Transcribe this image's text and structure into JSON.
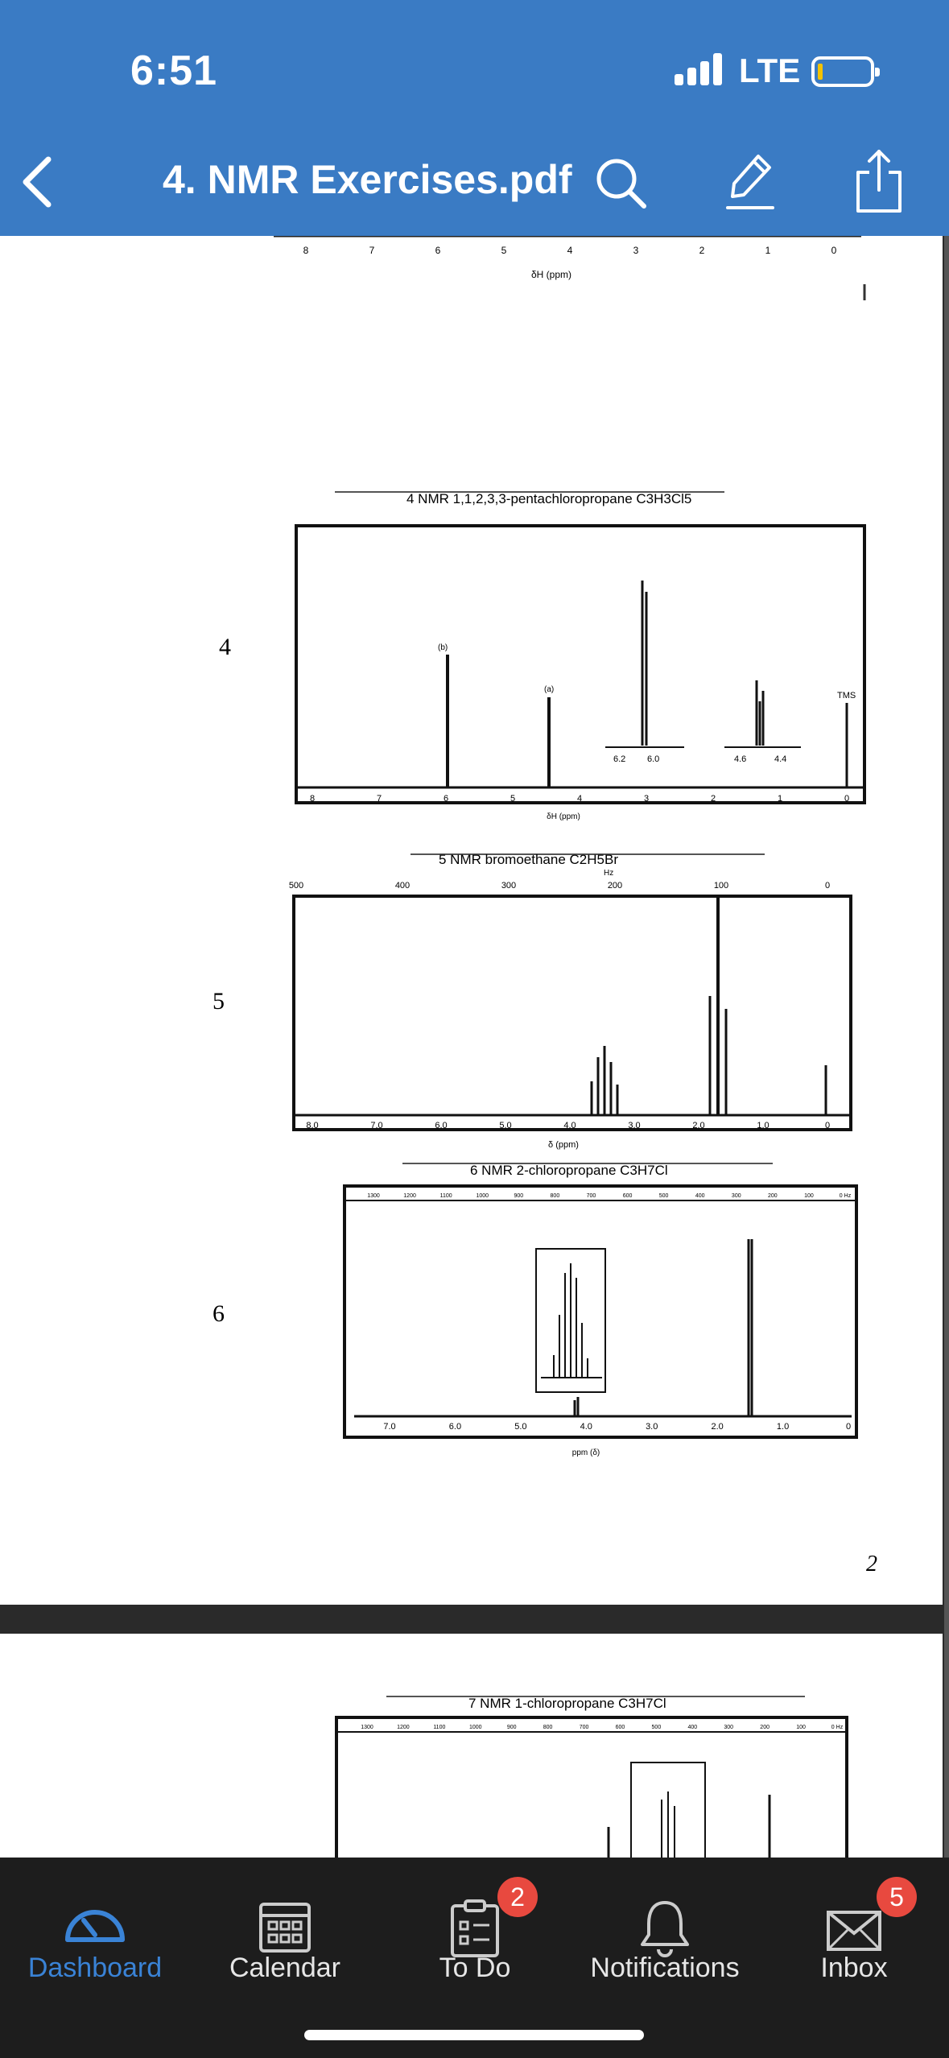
{
  "status_bar": {
    "time": "6:51",
    "carrier": "LTE"
  },
  "nav": {
    "title": "4. NMR Exercises.pdf"
  },
  "document": {
    "page_prev": {
      "axis_ticks": [
        "8",
        "7",
        "6",
        "5",
        "4",
        "3",
        "2",
        "1",
        "0"
      ],
      "axis_label": "δH (ppm)"
    },
    "page_current": {
      "problems": [
        {
          "number": "4",
          "caption": "4  NMR 1,1,2,3,3-pentachloropropane C3H3Cl5",
          "peak_labels": [
            "(b)",
            "(a)"
          ],
          "inset1_ticks": [
            "6.2",
            "6.0"
          ],
          "inset2_ticks": [
            "4.6",
            "4.4"
          ],
          "ref_label": "TMS",
          "axis_ticks": [
            "8",
            "7",
            "6",
            "5",
            "4",
            "3",
            "2",
            "1",
            "0"
          ],
          "axis_label": "δH (ppm)"
        },
        {
          "number": "5",
          "caption": "5  NMR bromoethane C2H5Br",
          "hz_label": "Hz",
          "hz_ticks": [
            "500",
            "400",
            "300",
            "200",
            "100",
            "0"
          ],
          "axis_ticks": [
            "8.0",
            "7.0",
            "6.0",
            "5.0",
            "4.0",
            "3.0",
            "2.0",
            "1.0",
            "0"
          ],
          "axis_label": "δ (ppm)"
        },
        {
          "number": "6",
          "caption": "6  NMR 2-chloropropane C3H7Cl",
          "hz_ticks": [
            "1300",
            "1200",
            "1100",
            "1000",
            "900",
            "800",
            "700",
            "600",
            "500",
            "400",
            "300",
            "200",
            "100",
            "0 Hz"
          ],
          "axis_ticks": [
            "7.0",
            "6.0",
            "5.0",
            "4.0",
            "3.0",
            "2.0",
            "1.0",
            "0"
          ],
          "axis_label": "ppm (δ)"
        }
      ],
      "page_number": "2"
    },
    "page_next": {
      "caption": "7  NMR 1-chloropropane C3H7Cl",
      "hz_ticks": [
        "1300",
        "1200",
        "1100",
        "1000",
        "900",
        "800",
        "700",
        "600",
        "500",
        "400",
        "300",
        "200",
        "100",
        "0 Hz"
      ]
    }
  },
  "tabs": [
    {
      "label": "Dashboard",
      "icon": "dashboard-icon",
      "active": true
    },
    {
      "label": "Calendar",
      "icon": "calendar-icon"
    },
    {
      "label": "To Do",
      "icon": "todo-icon",
      "badge": "2"
    },
    {
      "label": "Notifications",
      "icon": "bell-icon"
    },
    {
      "label": "Inbox",
      "icon": "inbox-icon",
      "badge": "5"
    }
  ],
  "colors": {
    "header": "#3a7bc4",
    "tabbar": "#1d1d1d",
    "active_tab": "#3a83d6",
    "badge": "#e8493f",
    "battery": "#f2c200"
  }
}
